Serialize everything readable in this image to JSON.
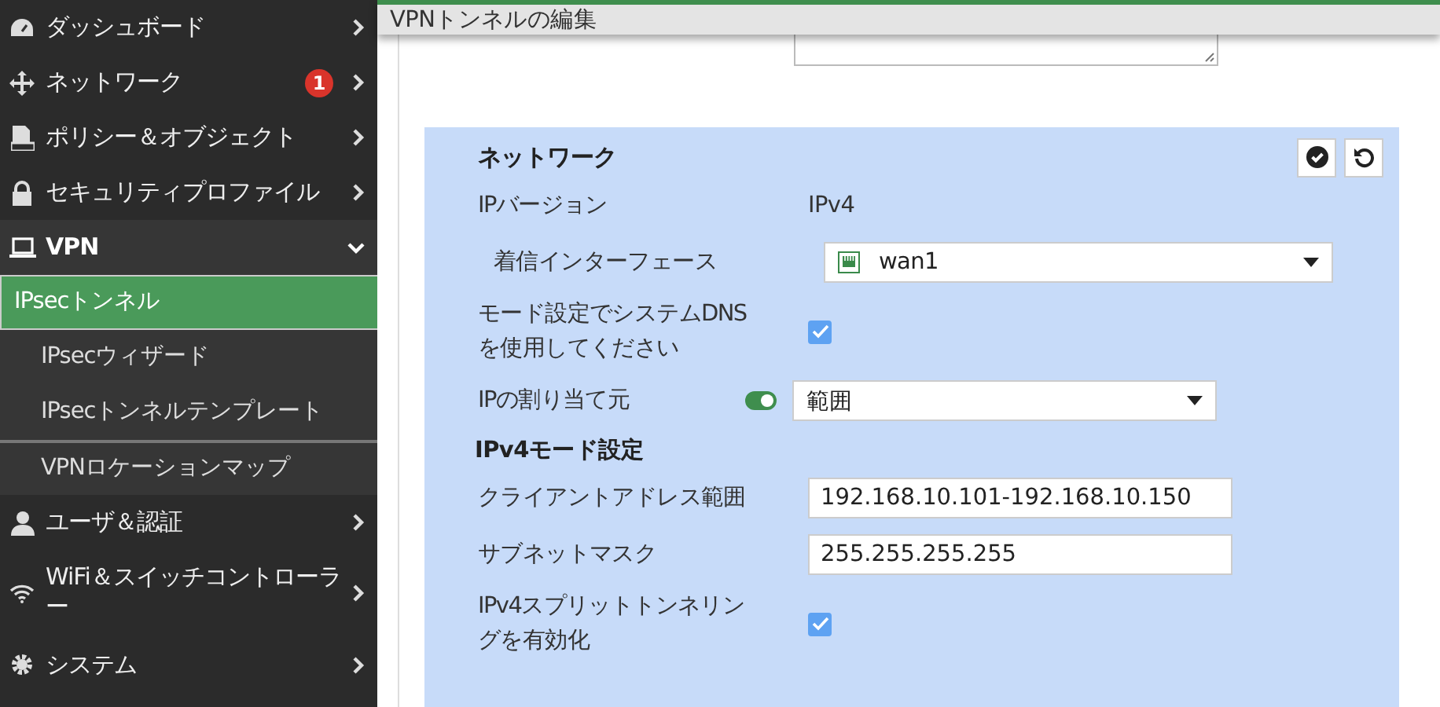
{
  "sidebar": {
    "items": [
      {
        "label": "ダッシュボード",
        "expanded": false
      },
      {
        "label": "ネットワーク",
        "badge": "1",
        "expanded": false
      },
      {
        "label": "ポリシー＆オブジェクト",
        "expanded": false
      },
      {
        "label": "セキュリティプロファイル",
        "expanded": false
      },
      {
        "label": "VPN",
        "expanded": true,
        "children": [
          {
            "label": "IPsecトンネル",
            "selected": true
          },
          {
            "label": "IPsecウィザード",
            "selected": false
          },
          {
            "label": "IPsecトンネルテンプレート",
            "selected": false
          },
          {
            "label": "VPNロケーションマップ",
            "selected": false
          }
        ]
      },
      {
        "label": "ユーザ＆認証",
        "expanded": false
      },
      {
        "label": "WiFi＆スイッチコントローラー",
        "expanded": false
      },
      {
        "label": "システム",
        "expanded": false
      }
    ]
  },
  "header": {
    "title": "VPNトンネルの編集"
  },
  "panel": {
    "title": "ネットワーク",
    "fields": [
      {
        "kind": "text",
        "label": "IPバージョン",
        "value": "IPv4"
      },
      {
        "kind": "select",
        "label": "着信インターフェース",
        "value": "wan1"
      },
      {
        "kind": "checkbox",
        "label": "モード設定でシステムDNSを使用してください",
        "checked": true
      },
      {
        "kind": "toggle-select",
        "label": "IPの割り当て元",
        "on": true,
        "value": "範囲"
      },
      {
        "kind": "section",
        "label": "IPv4モード設定"
      },
      {
        "kind": "input",
        "label": "クライアントアドレス範囲",
        "value": "192.168.10.101-192.168.10.150"
      },
      {
        "kind": "input",
        "label": "サブネットマスク",
        "value": "255.255.255.255"
      },
      {
        "kind": "checkbox",
        "label": "IPv4スプリットトンネリングを有効化",
        "checked": true
      }
    ]
  }
}
